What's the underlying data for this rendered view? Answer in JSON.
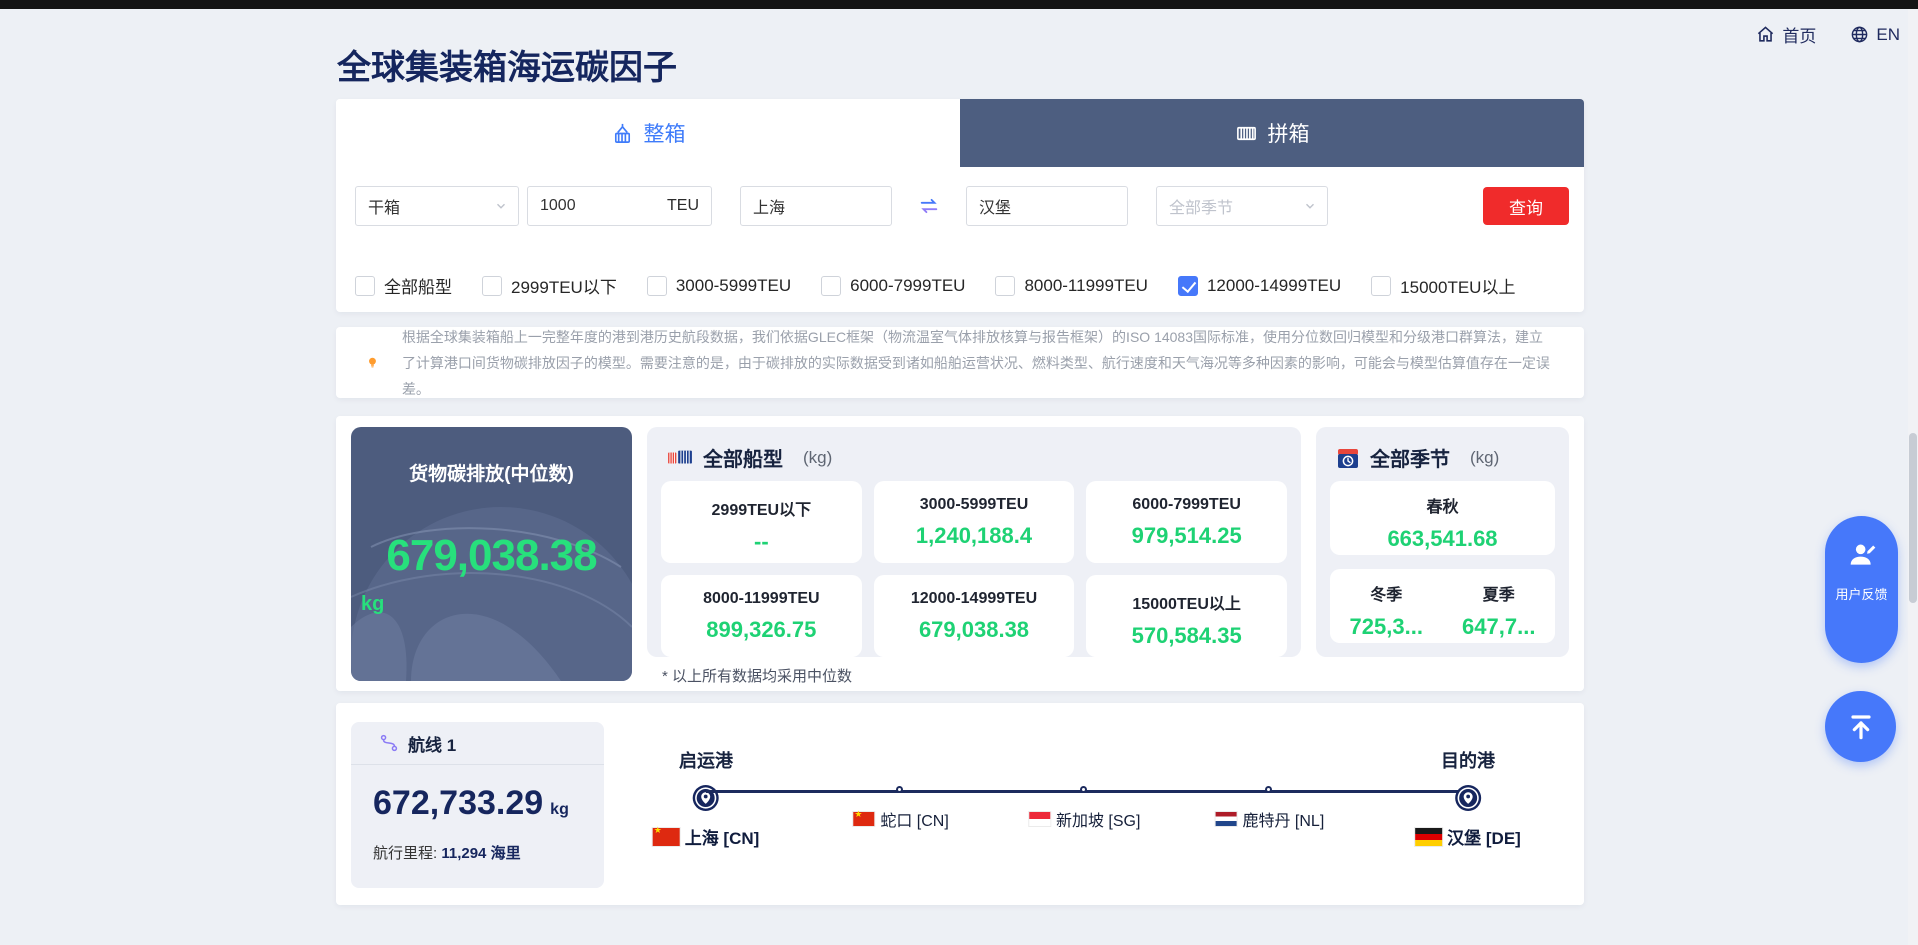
{
  "topnav": {
    "home_label": "首页",
    "lang_label": "EN"
  },
  "page": {
    "title": "全球集装箱海运碳因子"
  },
  "tabs": {
    "fcl": "整箱",
    "lcl": "拼箱"
  },
  "form": {
    "container_type": "干箱",
    "quantity": "1000",
    "quantity_unit": "TEU",
    "origin_port": "上海",
    "destination_port": "汉堡",
    "season": "全部季节",
    "search_label": "查询"
  },
  "filters": [
    {
      "label": "全部船型",
      "checked": false
    },
    {
      "label": "2999TEU以下",
      "checked": false
    },
    {
      "label": "3000-5999TEU",
      "checked": false
    },
    {
      "label": "6000-7999TEU",
      "checked": false
    },
    {
      "label": "8000-11999TEU",
      "checked": false
    },
    {
      "label": "12000-14999TEU",
      "checked": true
    },
    {
      "label": "15000TEU以上",
      "checked": false
    }
  ],
  "notice": {
    "text": "根据全球集装箱船上一完整年度的港到港历史航段数据，我们依据GLEC框架（物流温室气体排放核算与报告框架）的ISO 14083国际标准，使用分位数回归模型和分级港口群算法，建立了计算港口间货物碳排放因子的模型。需要注意的是，由于碳排放的实际数据受到诸如船舶运营状况、燃料类型、航行速度和天气海况等多种因素的影响，可能会与模型估算值存在一定误差。"
  },
  "summary": {
    "title": "货物碳排放(中位数)",
    "value": "679,038.38",
    "unit": "kg"
  },
  "ship_types": {
    "title": "全部船型",
    "unit": "(kg)",
    "cards": [
      {
        "label": "2999TEU以下",
        "value": "--"
      },
      {
        "label": "3000-5999TEU",
        "value": "1,240,188.4"
      },
      {
        "label": "6000-7999TEU",
        "value": "979,514.25"
      },
      {
        "label": "8000-11999TEU",
        "value": "899,326.75"
      },
      {
        "label": "12000-14999TEU",
        "value": "679,038.38"
      },
      {
        "label": "15000TEU以上",
        "value": "570,584.35"
      }
    ],
    "footnote": "* 以上所有数据均采用中位数"
  },
  "seasons": {
    "title": "全部季节",
    "unit": "(kg)",
    "primary": {
      "label": "春秋",
      "value": "663,541.68"
    },
    "secondary": [
      {
        "label": "冬季",
        "value": "725,3..."
      },
      {
        "label": "夏季",
        "value": "647,7..."
      }
    ]
  },
  "route": {
    "name": "航线 1",
    "value": "672,733.29",
    "unit": "kg",
    "distance_label": "航行里程:",
    "distance_value": "11,294 海里",
    "origin_label": "启运港",
    "destination_label": "目的港",
    "origin": {
      "name": "上海 [CN]",
      "flag": "cn"
    },
    "stops": [
      {
        "name": "蛇口 [CN]",
        "flag": "cn",
        "pos": 25.6
      },
      {
        "name": "新加坡 [SG]",
        "flag": "sg",
        "pos": 49.7
      },
      {
        "name": "鹿特丹 [NL]",
        "flag": "nl",
        "pos": 74.0
      }
    ],
    "destination": {
      "name": "汉堡 [DE]",
      "flag": "de"
    }
  },
  "floating": {
    "feedback_label": "用户反馈"
  },
  "colors": {
    "accent_blue": "#3e7bfa",
    "tab_slate": "#4d5e80",
    "value_green": "#1ed274",
    "button_red": "#f02b2b",
    "navy_text": "#15265e",
    "panel_gray": "#eef0f6"
  }
}
